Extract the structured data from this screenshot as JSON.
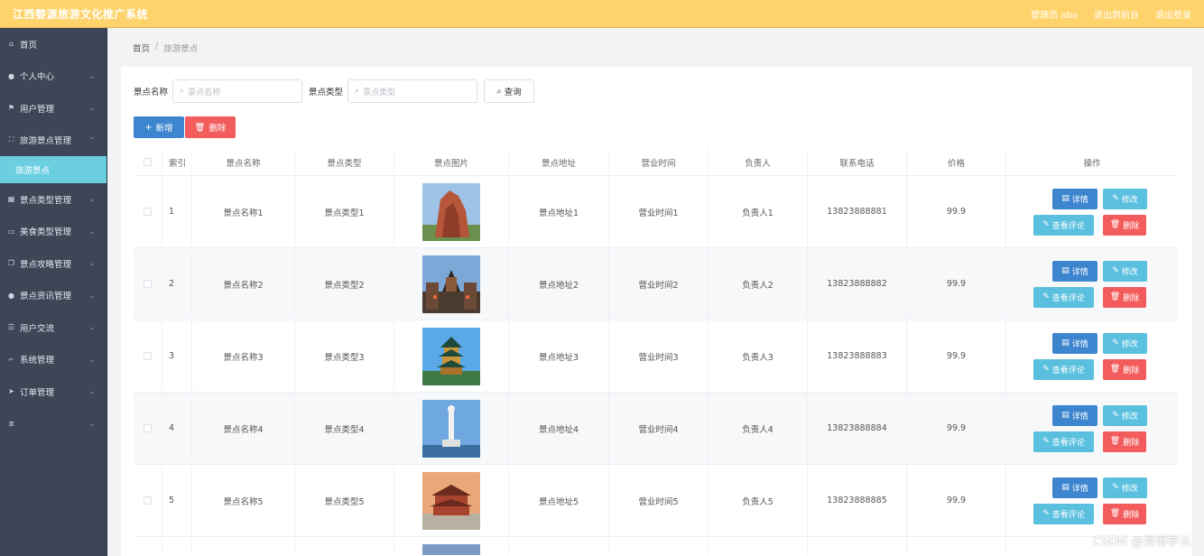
{
  "header": {
    "title": "江西婺源旅游文化推广系统",
    "admin": "管理员 abo",
    "to_frontend": "退出到前台",
    "logout": "退出登录"
  },
  "sidebar": {
    "items": [
      {
        "label": "首页",
        "icon": "home-icon",
        "has_chevron": false
      },
      {
        "label": "个人中心",
        "icon": "user-icon",
        "has_chevron": true
      },
      {
        "label": "用户管理",
        "icon": "flag-icon",
        "has_chevron": true
      },
      {
        "label": "旅游景点管理",
        "icon": "frame-icon",
        "has_chevron": true,
        "expanded": true
      },
      {
        "label": "景点类型管理",
        "icon": "grid-icon",
        "has_chevron": true
      },
      {
        "label": "美食类型管理",
        "icon": "image-icon",
        "has_chevron": true
      },
      {
        "label": "景点攻略管理",
        "icon": "copy-icon",
        "has_chevron": true
      },
      {
        "label": "景点资讯管理",
        "icon": "user-icon",
        "has_chevron": true
      },
      {
        "label": "用户交流",
        "icon": "sliders-icon",
        "has_chevron": true
      },
      {
        "label": "系统管理",
        "icon": "crop-icon",
        "has_chevron": true
      },
      {
        "label": "订单管理",
        "icon": "send-icon",
        "has_chevron": true
      },
      {
        "label": "",
        "icon": "list-icon",
        "has_chevron": true
      }
    ],
    "subitem": "旅游景点"
  },
  "breadcrumb": {
    "home": "首页",
    "sep": "/",
    "current": "旅游景点"
  },
  "search": {
    "name_label": "景点名称",
    "name_placeholder": "景点名称",
    "type_label": "景点类型",
    "type_placeholder": "景点类型",
    "query_button": "查询"
  },
  "actions": {
    "add": "新增",
    "delete": "删除"
  },
  "table": {
    "headers": [
      "",
      "索引",
      "景点名称",
      "景点类型",
      "景点图片",
      "景点地址",
      "营业时间",
      "负责人",
      "联系电话",
      "价格",
      "操作"
    ],
    "rows": [
      {
        "index": "1",
        "name": "景点名称1",
        "type": "景点类型1",
        "address": "景点地址1",
        "hours": "营业时间1",
        "owner": "负责人1",
        "phone": "13823888881",
        "price": "99.9"
      },
      {
        "index": "2",
        "name": "景点名称2",
        "type": "景点类型2",
        "address": "景点地址2",
        "hours": "营业时间2",
        "owner": "负责人2",
        "phone": "13823888882",
        "price": "99.9"
      },
      {
        "index": "3",
        "name": "景点名称3",
        "type": "景点类型3",
        "address": "景点地址3",
        "hours": "营业时间3",
        "owner": "负责人3",
        "phone": "13823888883",
        "price": "99.9"
      },
      {
        "index": "4",
        "name": "景点名称4",
        "type": "景点类型4",
        "address": "景点地址4",
        "hours": "营业时间4",
        "owner": "负责人4",
        "phone": "13823888884",
        "price": "99.9"
      },
      {
        "index": "5",
        "name": "景点名称5",
        "type": "景点类型5",
        "address": "景点地址5",
        "hours": "营业时间5",
        "owner": "负责人5",
        "phone": "13823888885",
        "price": "99.9"
      }
    ],
    "row_buttons": {
      "detail": "详情",
      "edit": "修改",
      "comments": "查看评论",
      "delete": "删除"
    }
  },
  "watermark": "CSDN @爱得学长",
  "colors": {
    "topbar": "#ffd36b",
    "sidebar": "#3c4657",
    "active_subitem": "#6ccfe0",
    "primary": "#3d86cf",
    "info": "#5ac0de",
    "danger": "#f25c5c"
  }
}
